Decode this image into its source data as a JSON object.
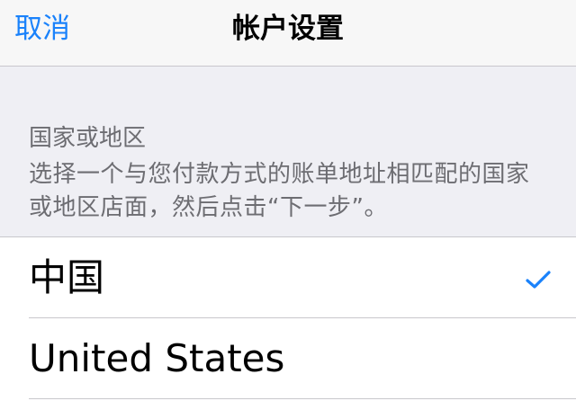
{
  "nav": {
    "cancel_label": "取消",
    "title": "帐户设置"
  },
  "section": {
    "header": "国家或地区",
    "description": "选择一个与您付款方式的账单地址相匹配的国家或地区店面，然后点击“下一步”。"
  },
  "countries": [
    {
      "label": "中国",
      "selected": true
    },
    {
      "label": "United States",
      "selected": false
    }
  ],
  "colors": {
    "accent": "#1a82fb",
    "checkmark": "#1a82fb",
    "background": "#efeff4",
    "secondary_text": "#6d6d72"
  },
  "icons": {
    "selected_indicator": "checkmark-icon"
  }
}
